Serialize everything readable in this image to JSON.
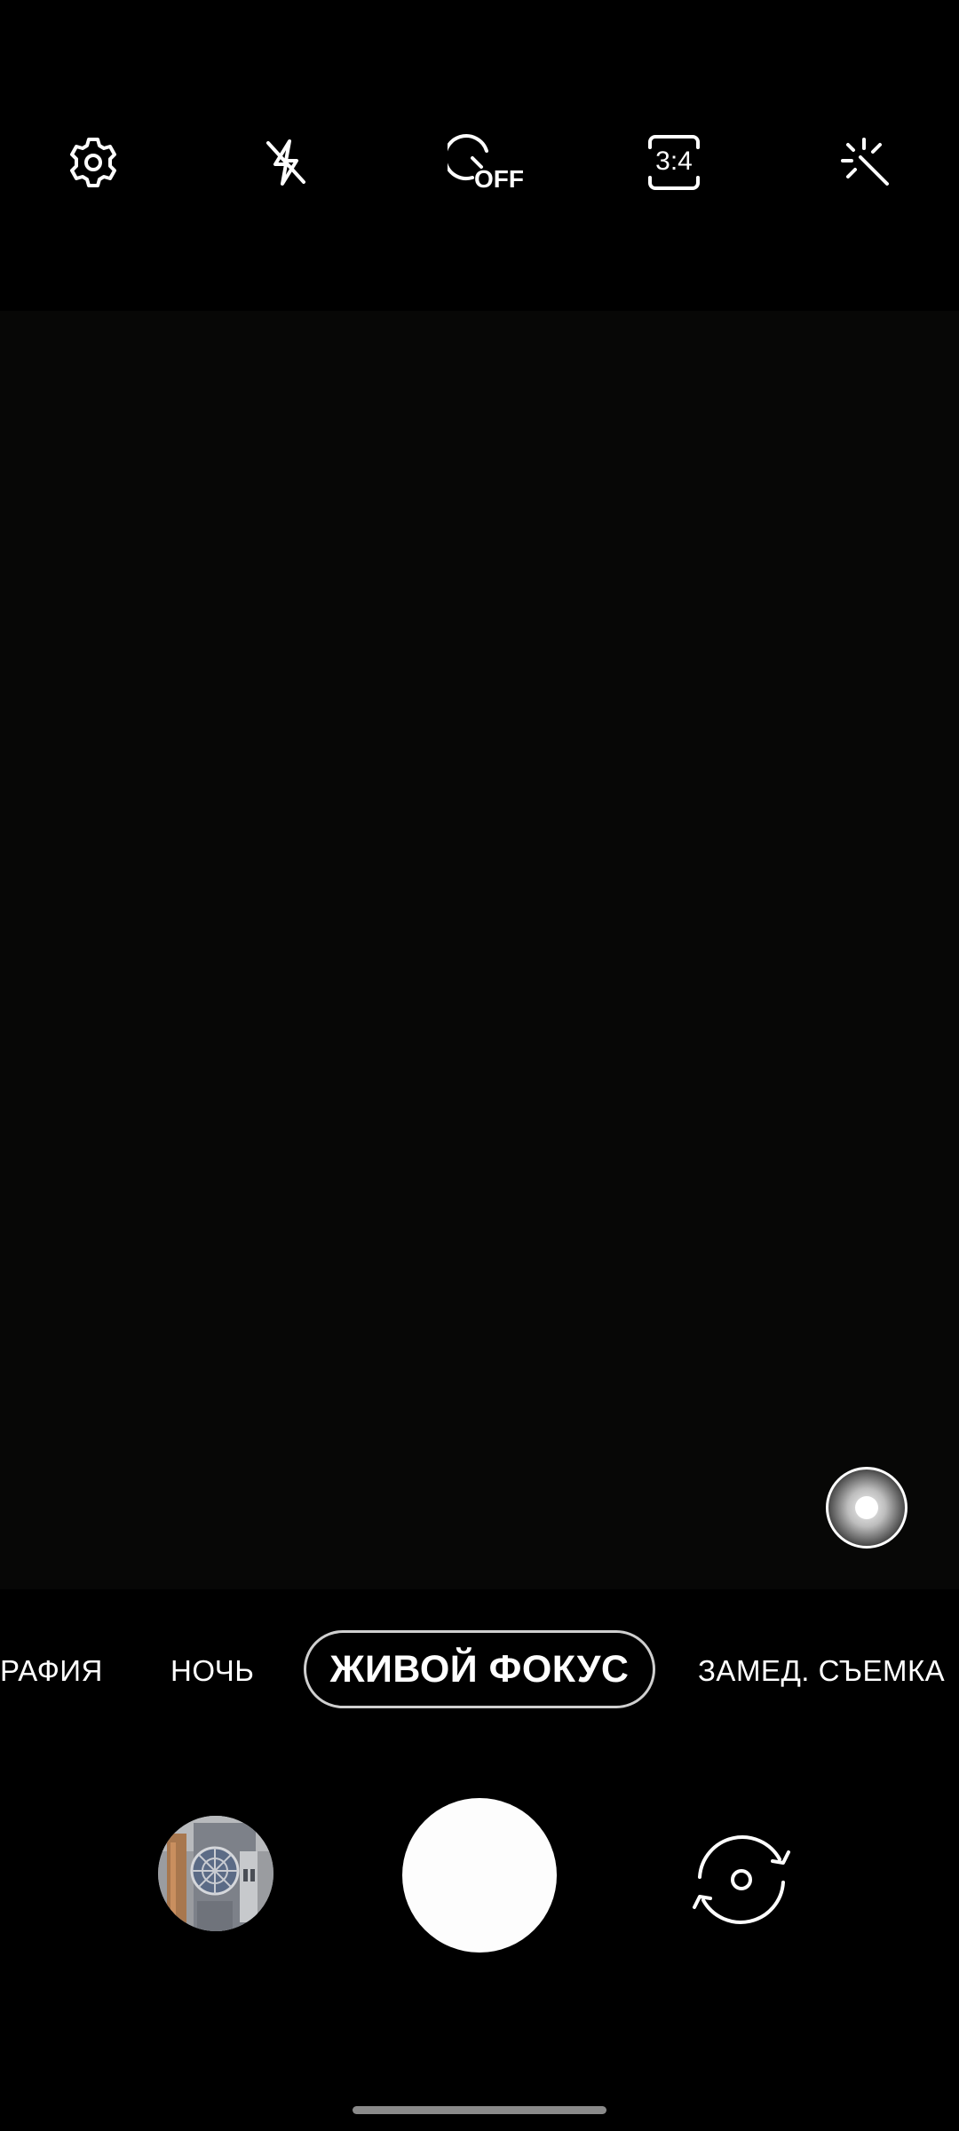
{
  "top_bar": {
    "settings_icon": "gear-icon",
    "flash_icon": "flash-off-icon",
    "timer_icon": "timer-off-icon",
    "timer_label": "OFF",
    "ratio_icon": "aspect-ratio-icon",
    "ratio_label": "3:4",
    "effects_icon": "magic-wand-icon"
  },
  "viewfinder": {
    "focus_toggle_icon": "focus-effect-icon"
  },
  "modes": {
    "items": [
      {
        "label": "РАФИЯ",
        "selected": false
      },
      {
        "label": "НОЧЬ",
        "selected": false
      },
      {
        "label": "ЖИВОЙ ФОКУС",
        "selected": true
      },
      {
        "label": "ЗАМЕД. СЪЕМКА",
        "selected": false
      }
    ]
  },
  "controls": {
    "gallery_icon": "gallery-thumbnail",
    "shutter_icon": "shutter-button",
    "switch_camera_icon": "switch-camera-icon"
  },
  "colors": {
    "background": "#000000",
    "viewfinder": "#070706",
    "foreground": "#ffffff",
    "selected_border": "#cfcfcf"
  }
}
